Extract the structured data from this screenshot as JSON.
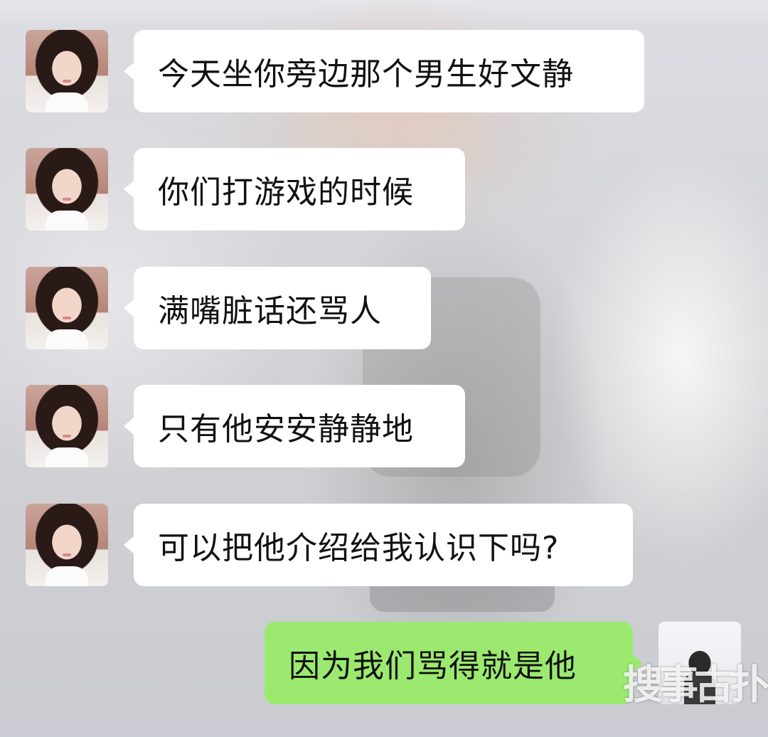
{
  "chat": {
    "messages": [
      {
        "sender": "other",
        "avatar": "girl-avatar",
        "text": "今天坐你旁边那个男生好文静"
      },
      {
        "sender": "other",
        "avatar": "girl-avatar",
        "text": "你们打游戏的时候"
      },
      {
        "sender": "other",
        "avatar": "girl-avatar",
        "text": "满嘴脏话还骂人"
      },
      {
        "sender": "other",
        "avatar": "girl-avatar",
        "text": "只有他安安静静地"
      },
      {
        "sender": "other",
        "avatar": "girl-avatar",
        "text": "可以把他介绍给我认识下吗?"
      },
      {
        "sender": "me",
        "avatar": "boy-avatar",
        "text": "因为我们骂得就是他"
      }
    ]
  },
  "watermark": {
    "text": "搜事古扑"
  },
  "colors": {
    "incoming_bubble": "#ffffff",
    "outgoing_bubble": "#9bea6f",
    "text": "#111111"
  }
}
